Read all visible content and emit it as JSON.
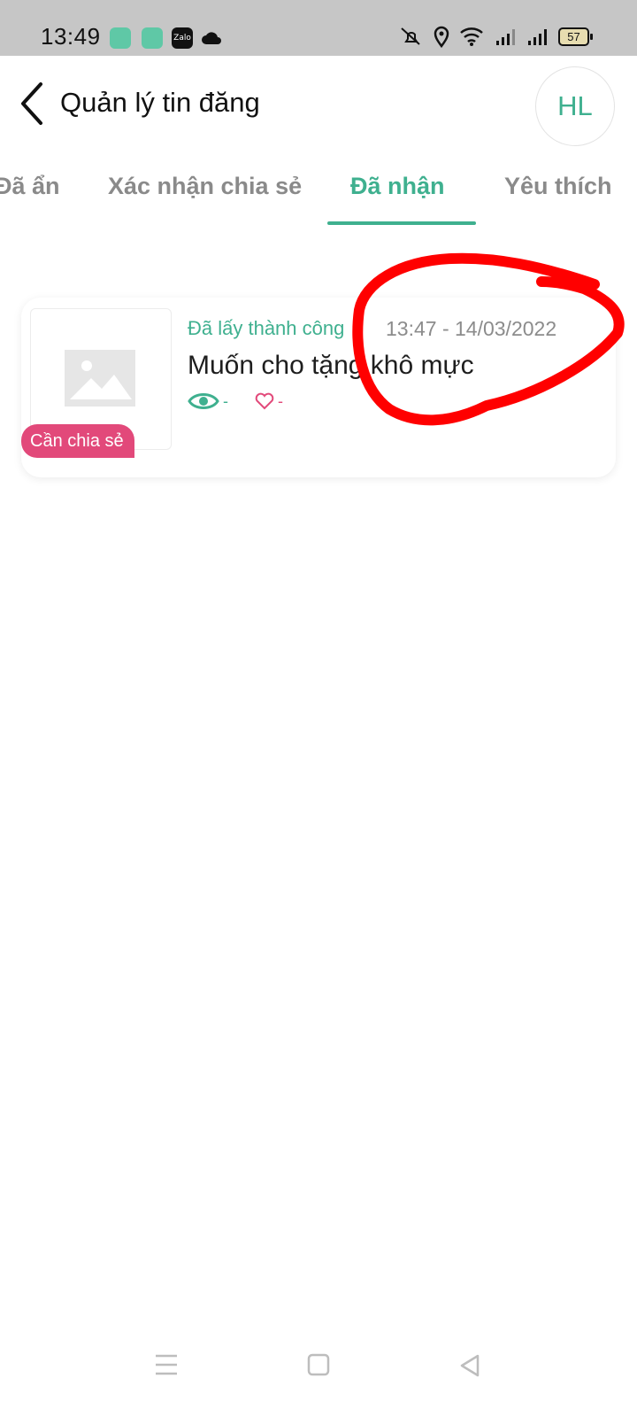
{
  "status_bar": {
    "time": "13:49",
    "zalo_label": "Zalo",
    "battery": "57",
    "icons": [
      "app-icon-green",
      "app-icon-green-2",
      "zalo-icon",
      "cloud-icon",
      "mute-icon",
      "location-icon",
      "wifi-icon",
      "signal-icon",
      "signal-icon-2",
      "battery-icon"
    ]
  },
  "header": {
    "title": "Quản lý tin đăng",
    "avatar_initials": "HL"
  },
  "tabs": [
    {
      "label": "Đã ẩn",
      "active": false
    },
    {
      "label": "Xác nhận chia sẻ",
      "active": false
    },
    {
      "label": "Đã nhận",
      "active": true
    },
    {
      "label": "Yêu thích",
      "active": false
    }
  ],
  "post": {
    "status": "Đã lấy thành công",
    "timestamp": "13:47 - 14/03/2022",
    "title": "Muốn cho tặng khô mực",
    "badge": "Cần chia sẻ",
    "views": "-",
    "likes": "-"
  },
  "colors": {
    "accent": "#3fb08f",
    "badge": "#e2497a",
    "annotation": "#ff0000"
  }
}
